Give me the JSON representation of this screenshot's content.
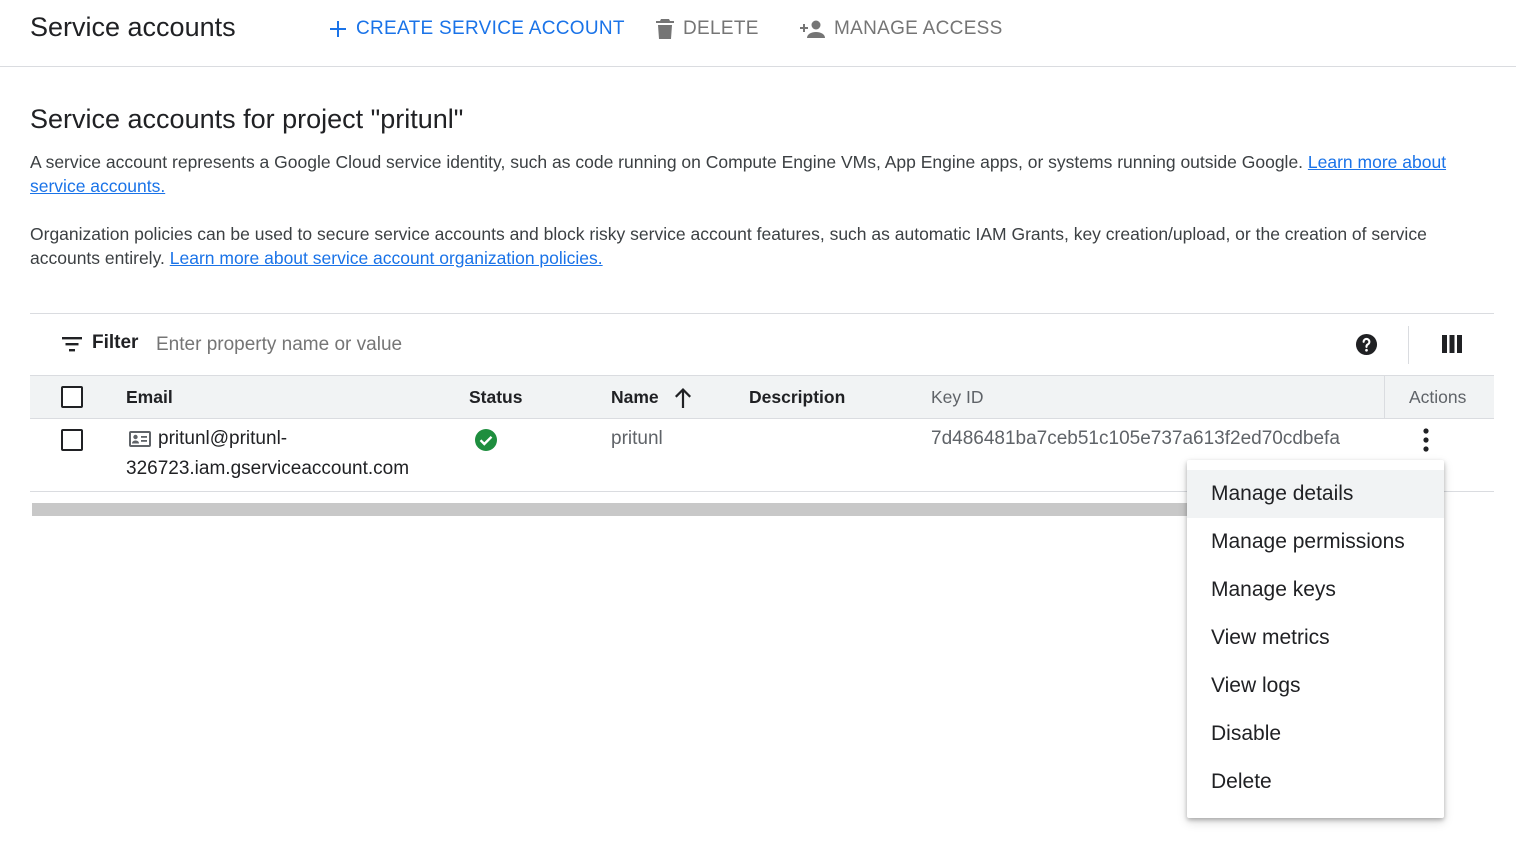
{
  "header": {
    "title": "Service accounts",
    "create_label": "CREATE SERVICE ACCOUNT",
    "delete_label": "DELETE",
    "manage_access_label": "MANAGE ACCESS"
  },
  "content": {
    "section_title": "Service accounts for project \"pritunl\"",
    "intro_text": "A service account represents a Google Cloud service identity, such as code running on Compute Engine VMs, App Engine apps, or systems running outside Google. ",
    "intro_link": "Learn more about service accounts.",
    "policy_text": "Organization policies can be used to secure service accounts and block risky service account features, such as automatic IAM Grants, key creation/upload, or the creation of service accounts entirely. ",
    "policy_link": "Learn more about service account organization policies."
  },
  "filter": {
    "label": "Filter",
    "placeholder": "Enter property name or value"
  },
  "table": {
    "columns": {
      "email": "Email",
      "status": "Status",
      "name": "Name",
      "description": "Description",
      "key_id": "Key ID",
      "actions": "Actions"
    },
    "sort": {
      "column": "Name",
      "direction": "ascending"
    },
    "rows": [
      {
        "email_line1": "pritunl@pritunl-",
        "email_line2": "326723.iam.gserviceaccount.com",
        "status": "enabled",
        "name": "pritunl",
        "description": "",
        "key_id": "7d486481ba7ceb51c105e737a613f2ed70cdbefa"
      }
    ]
  },
  "menu": {
    "items": [
      "Manage details",
      "Manage permissions",
      "Manage keys",
      "View metrics",
      "View logs",
      "Disable",
      "Delete"
    ],
    "highlighted": "Manage details"
  },
  "colors": {
    "accent": "#1a73e8",
    "status_ok": "#1e8e3e",
    "muted": "#757575"
  }
}
